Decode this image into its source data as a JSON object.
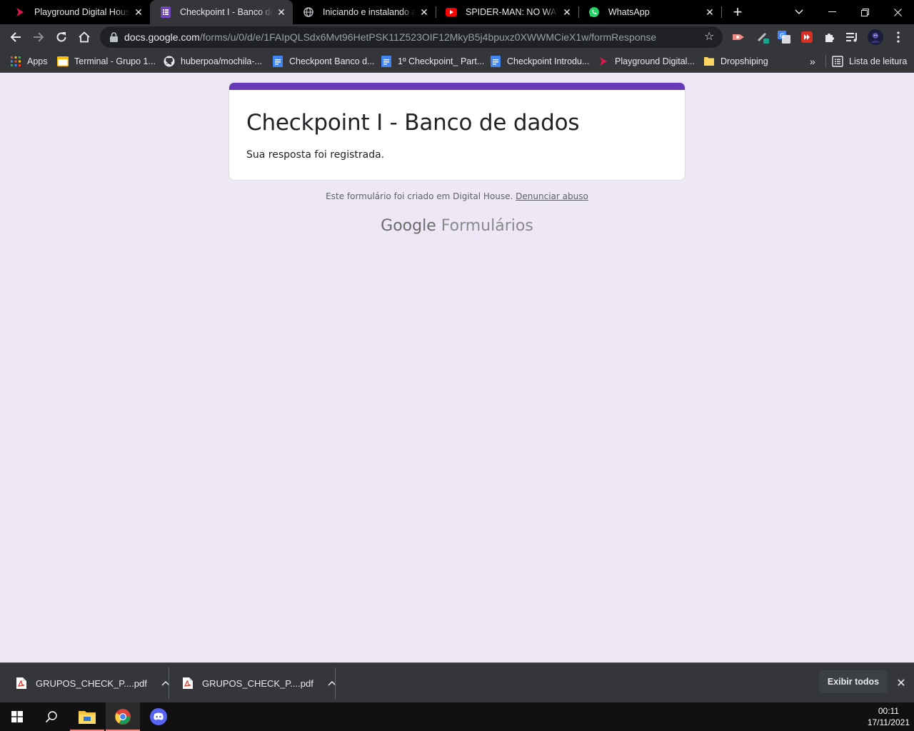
{
  "tabs": [
    {
      "title": "Playground Digital House",
      "icon": "digital-house-icon",
      "active": false
    },
    {
      "title": "Checkpoint I - Banco de dados",
      "icon": "google-forms-icon",
      "active": true
    },
    {
      "title": "Iniciando e instalando a base",
      "icon": "globe-icon",
      "active": false
    },
    {
      "title": "SPIDER-MAN: NO WAY HOME",
      "icon": "youtube-icon",
      "active": false
    },
    {
      "title": "WhatsApp",
      "icon": "whatsapp-icon",
      "active": false
    }
  ],
  "address_bar": {
    "host": "docs.google.com",
    "path": "/forms/u/0/d/e/1FAIpQLSdx6Mvt96HetPSK11Z523OIF12MkyB5j4bpuxz0XWWMCieX1w/formResponse"
  },
  "bookmarks": [
    {
      "label": "Apps",
      "icon": "apps-grid-icon"
    },
    {
      "label": "Terminal - Grupo 1...",
      "icon": "folder-icon"
    },
    {
      "label": "huberpoa/mochila-...",
      "icon": "github-icon"
    },
    {
      "label": "Checkpont Banco d...",
      "icon": "google-docs-icon"
    },
    {
      "label": "1º Checkpoint_ Part...",
      "icon": "google-docs-icon"
    },
    {
      "label": "Checkpoint Introdu...",
      "icon": "google-docs-icon"
    },
    {
      "label": "Playground Digital...",
      "icon": "digital-house-icon"
    },
    {
      "label": "Dropshiping",
      "icon": "folder-icon"
    }
  ],
  "reading_list": {
    "label": "Lista de leitura"
  },
  "overflow_label": "»",
  "form": {
    "title": "Checkpoint I - Banco de dados",
    "message": "Sua resposta foi registrada.",
    "accent_color": "#673ab7"
  },
  "footer": {
    "note": "Este formulário foi criado em Digital House.",
    "abuse_link": "Denunciar abuso",
    "brand_google": "Google",
    "brand_product": "Formulários"
  },
  "downloads": [
    {
      "filename": "GRUPOS_CHECK_P....pdf",
      "icon": "pdf-icon"
    },
    {
      "filename": "GRUPOS_CHECK_P....pdf",
      "icon": "pdf-icon"
    }
  ],
  "downloads_show_all": "Exibir todos",
  "taskbar": {
    "time": "00:11",
    "date": "17/11/2021"
  }
}
